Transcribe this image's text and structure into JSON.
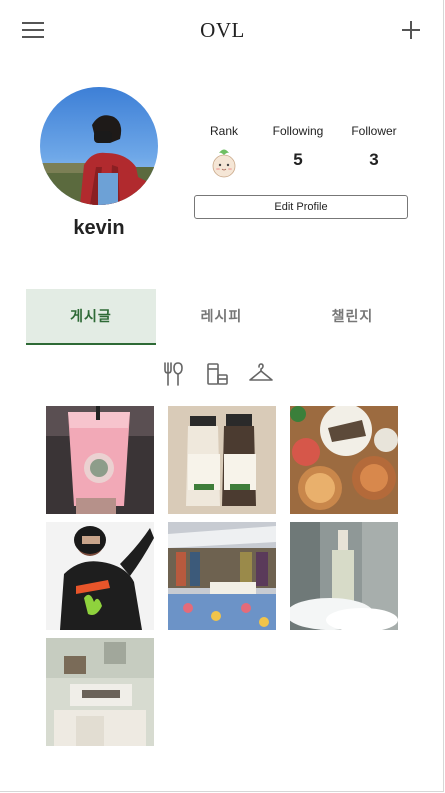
{
  "header": {
    "title": "OVL",
    "menu_icon": "hamburger-menu-icon",
    "add_icon": "plus-icon"
  },
  "profile": {
    "username": "kevin",
    "stats": {
      "rank_label": "Rank",
      "rank_badge_icon": "rank-character-icon",
      "following_label": "Following",
      "following_value": "5",
      "follower_label": "Follower",
      "follower_value": "3"
    },
    "edit_button": "Edit Profile"
  },
  "tabs": [
    {
      "label": "게시글",
      "active": true
    },
    {
      "label": "레시피",
      "active": false
    },
    {
      "label": "챌린지",
      "active": false
    }
  ],
  "category_icons": [
    "food-utensils-icon",
    "drink-cup-icon",
    "clothes-hanger-icon"
  ],
  "posts": [
    {
      "alt": "pink-drink-photo"
    },
    {
      "alt": "milk-bottles-photo"
    },
    {
      "alt": "food-dishes-photo"
    },
    {
      "alt": "person-photo"
    },
    {
      "alt": "market-stall-photo"
    },
    {
      "alt": "cosmetic-bottle-photo"
    },
    {
      "alt": "bathroom-sign-photo"
    }
  ],
  "colors": {
    "accent": "#2e6a36",
    "active_tab_bg": "#e3ece4"
  }
}
